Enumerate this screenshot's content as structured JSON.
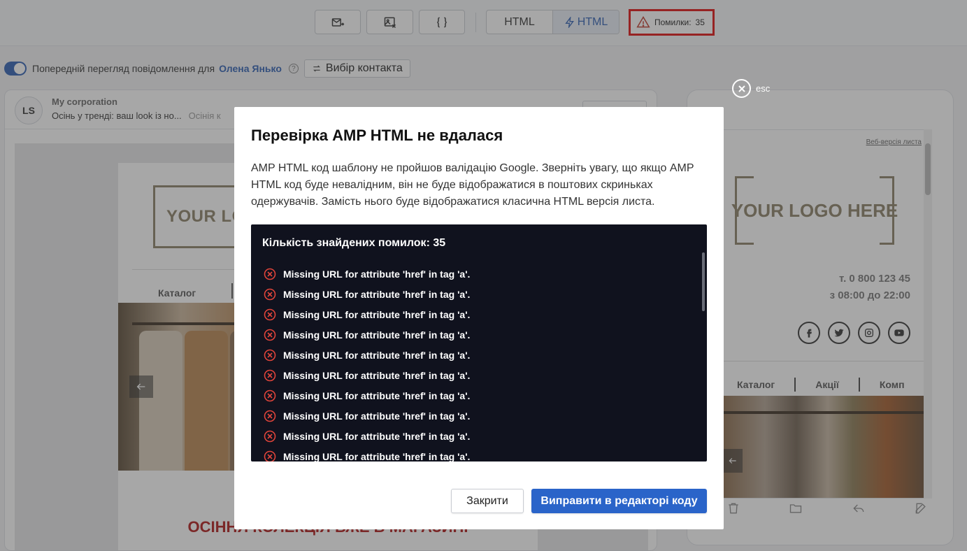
{
  "toolbar": {
    "buttons": [
      {
        "icon": "send-test-email-icon"
      },
      {
        "icon": "image-off-icon"
      },
      {
        "icon": "code-braces-icon"
      }
    ],
    "format_html": "HTML",
    "format_amp": "HTML",
    "errors_label": "Помилки:",
    "errors_count": "35"
  },
  "preview": {
    "label": "Попередній перегляд повідомлення для",
    "contact_name": "Олена Янько",
    "help": "?",
    "choose_contact": "Вибір контакта"
  },
  "mail": {
    "avatar": "LS",
    "sender": "My corporation",
    "subject": "Осінь у тренді: ваш look із но...",
    "preheader": "Осінія к",
    "logo_text": "YOUR LOGO HERE",
    "nav_first": "Каталог",
    "collection_title": "ОСІННЯ КОЛЕКЦІЯ ВЖЕ В МАГАЗИНІ"
  },
  "mobile": {
    "web_version": "Веб-версія листа",
    "logo_text": "YOUR LOGO HERE",
    "phone": "т. 0 800 123 45",
    "hours": "з 08:00 до 22:00",
    "socials": [
      "facebook-icon",
      "twitter-icon",
      "instagram-icon",
      "youtube-icon"
    ],
    "nav": [
      "Каталог",
      "Акції",
      "Комп"
    ]
  },
  "esc_label": "esc",
  "modal": {
    "title": "Перевірка AMP HTML не вдалася",
    "description": "AMP HTML код шаблону не пройшов валідацію Google. Зверніть увагу, що якщо AMP HTML код буде невалідним, він не буде відображатися в поштових скриньках одержувачів. Замість нього буде відображатися класична HTML версія листа.",
    "errors_heading": "Кількість знайдених помилок: 35",
    "errors": [
      "Missing URL for attribute 'href' in tag 'a'.",
      "Missing URL for attribute 'href' in tag 'a'.",
      "Missing URL for attribute 'href' in tag 'a'.",
      "Missing URL for attribute 'href' in tag 'a'.",
      "Missing URL for attribute 'href' in tag 'a'.",
      "Missing URL for attribute 'href' in tag 'a'.",
      "Missing URL for attribute 'href' in tag 'a'.",
      "Missing URL for attribute 'href' in tag 'a'.",
      "Missing URL for attribute 'href' in tag 'a'.",
      "Missing URL for attribute 'href' in tag 'a'."
    ],
    "close_label": "Закрити",
    "fix_label": "Виправити в редакторі коду"
  },
  "colors": {
    "accent": "#2a64c9",
    "error_border": "#e01010",
    "error_icon": "#e0443a",
    "errors_bg": "#10121e"
  }
}
